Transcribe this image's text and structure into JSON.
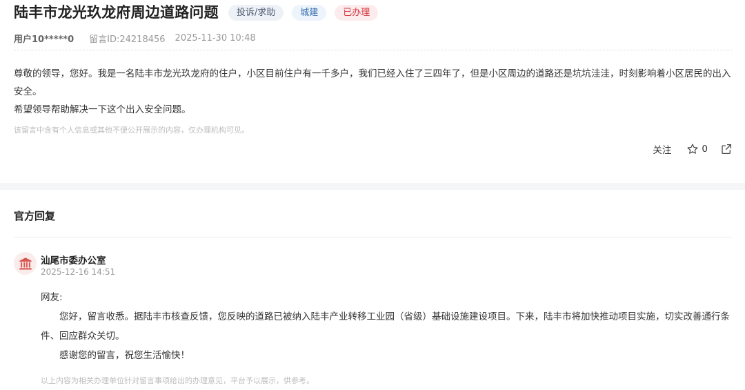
{
  "post": {
    "title": "陆丰市龙光玖龙府周边道路问题",
    "tags": {
      "type": "投诉/求助",
      "field": "城建",
      "status": "已办理"
    },
    "user": "用户10*****0",
    "message_id": "留言ID:24218456",
    "time": "2025-11-30 10:48",
    "body_line1": "尊敬的领导，您好。我是一名陆丰市龙光玖龙府的住户，小区目前住户有一千多户，我们已经入住了三四年了，但是小区周边的道路还是坑坑洼洼，时刻影响着小区居民的出入安全。",
    "body_line2": "希望领导帮助解决一下这个出入安全问题。",
    "privacy_notice": "该留言中含有个人信息或其他不便公开展示的内容，仅办理机构可见。",
    "actions": {
      "follow_label": "关注",
      "like_count": "0",
      "star_icon": "star-outline-icon",
      "share_icon": "share-icon"
    }
  },
  "reply": {
    "section_title": "官方回复",
    "org_name": "汕尾市委办公室",
    "org_icon": "government-building-icon",
    "time": "2025-12-16 14:51",
    "greeting": "网友:",
    "paragraph1": "您好，留言收悉。据陆丰市核查反馈，您反映的道路已被纳入陆丰产业转移工业园（省级）基础设施建设项目。下来，陆丰市将加快推动项目实施，切实改善通行条件、回应群众关切。",
    "paragraph2": "感谢您的留言，祝您生活愉快！",
    "footer_note": "以上内容为相关办理单位针对留言事项给出的办理意见，平台予以展示，供参考。"
  },
  "colors": {
    "status_red": "#d4383f",
    "field_blue": "#3a6fb0",
    "avatar_bg": "#fbecec",
    "avatar_icon": "#d9534f"
  }
}
